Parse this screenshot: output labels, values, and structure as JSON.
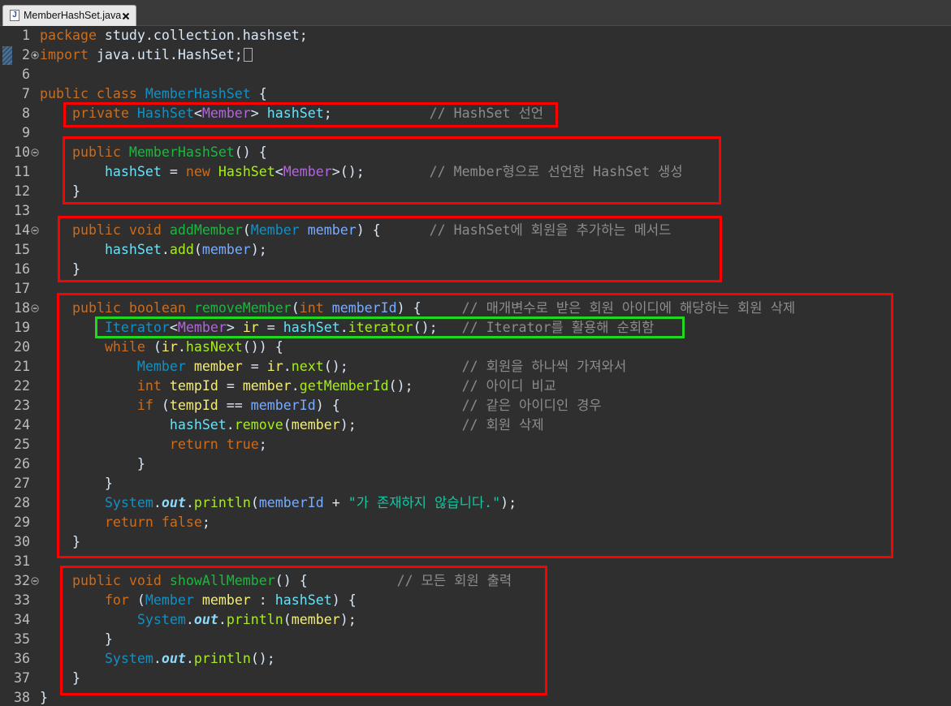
{
  "tab": {
    "icon": "java-file-icon",
    "icon_label": "J",
    "label": "MemberHashSet.java",
    "close_icon": "close-icon"
  },
  "syntax_colors": {
    "kw": "#CC6C1D",
    "pl": "#D9E8F7",
    "cls": "#1290C3",
    "ta": "#B166DA",
    "fld": "#66E1F8",
    "md": "#1EB540",
    "mc": "#A7EC21",
    "par": "#79ABFF",
    "loc": "#F3EC79",
    "sf": "#8DDAF8",
    "cm": "#8C8C8C",
    "str": "#17C6A3"
  },
  "highlight_colors": {
    "red": "#FF0000",
    "green": "#1FD81F"
  },
  "editor": {
    "lines": [
      {
        "number": "1",
        "tokens": [
          [
            "package",
            "kw"
          ],
          [
            " study.collection.hashset;",
            "pl"
          ]
        ]
      },
      {
        "number": "2",
        "fold": "fold-expand-icon",
        "gutter_marker": "quick-diff-marker-icon",
        "folded_marker": "folded-code-icon",
        "tokens": [
          [
            "import",
            "kw"
          ],
          [
            " java.util.HashSet;",
            "pl"
          ]
        ]
      },
      {
        "number": "6",
        "tokens": []
      },
      {
        "number": "7",
        "tokens": [
          [
            "public class",
            "kw"
          ],
          [
            " ",
            "pl"
          ],
          [
            "MemberHashSet",
            "cls"
          ],
          [
            " {",
            "pl"
          ]
        ]
      },
      {
        "number": "8",
        "tokens": [
          [
            "    ",
            "pl"
          ],
          [
            "private",
            "kw"
          ],
          [
            " ",
            "pl"
          ],
          [
            "HashSet",
            "cls"
          ],
          [
            "<",
            "pl"
          ],
          [
            "Member",
            "ta"
          ],
          [
            "> ",
            "pl"
          ],
          [
            "hashSet",
            "fld"
          ],
          [
            ";",
            "pl"
          ],
          [
            "            ",
            "pl"
          ],
          [
            "// HashSet 선언",
            "cm"
          ]
        ]
      },
      {
        "number": "9",
        "tokens": []
      },
      {
        "number": "10",
        "fold": "fold-collapse-icon",
        "tokens": [
          [
            "    ",
            "pl"
          ],
          [
            "public",
            "kw"
          ],
          [
            " ",
            "pl"
          ],
          [
            "MemberHashSet",
            "md"
          ],
          [
            "() {",
            "pl"
          ]
        ]
      },
      {
        "number": "11",
        "tokens": [
          [
            "        ",
            "pl"
          ],
          [
            "hashSet",
            "fld"
          ],
          [
            " = ",
            "pl"
          ],
          [
            "new",
            "kw"
          ],
          [
            " ",
            "pl"
          ],
          [
            "HashSet",
            "mc"
          ],
          [
            "<",
            "pl"
          ],
          [
            "Member",
            "ta"
          ],
          [
            ">();",
            "pl"
          ],
          [
            "        ",
            "pl"
          ],
          [
            "// Member형으로 선언한 HashSet 생성",
            "cm"
          ]
        ]
      },
      {
        "number": "12",
        "tokens": [
          [
            "    }",
            "pl"
          ]
        ]
      },
      {
        "number": "13",
        "tokens": []
      },
      {
        "number": "14",
        "fold": "fold-collapse-icon",
        "tokens": [
          [
            "    ",
            "pl"
          ],
          [
            "public void",
            "kw"
          ],
          [
            " ",
            "pl"
          ],
          [
            "addMember",
            "md"
          ],
          [
            "(",
            "pl"
          ],
          [
            "Member",
            "cls"
          ],
          [
            " ",
            "pl"
          ],
          [
            "member",
            "par"
          ],
          [
            ") {",
            "pl"
          ],
          [
            "      ",
            "pl"
          ],
          [
            "// HashSet에 회원을 추가하는 메서드",
            "cm"
          ]
        ]
      },
      {
        "number": "15",
        "tokens": [
          [
            "        ",
            "pl"
          ],
          [
            "hashSet",
            "fld"
          ],
          [
            ".",
            "pl"
          ],
          [
            "add",
            "mc"
          ],
          [
            "(",
            "pl"
          ],
          [
            "member",
            "par"
          ],
          [
            ");",
            "pl"
          ]
        ]
      },
      {
        "number": "16",
        "tokens": [
          [
            "    }",
            "pl"
          ]
        ]
      },
      {
        "number": "17",
        "tokens": []
      },
      {
        "number": "18",
        "fold": "fold-collapse-icon",
        "tokens": [
          [
            "    ",
            "pl"
          ],
          [
            "public boolean",
            "kw"
          ],
          [
            " ",
            "pl"
          ],
          [
            "removeMember",
            "md"
          ],
          [
            "(",
            "pl"
          ],
          [
            "int",
            "kw"
          ],
          [
            " ",
            "pl"
          ],
          [
            "memberId",
            "par"
          ],
          [
            ") {",
            "pl"
          ],
          [
            "     ",
            "pl"
          ],
          [
            "// 매개변수로 받은 회원 아이디에 해당하는 회원 삭제",
            "cm"
          ]
        ]
      },
      {
        "number": "19",
        "tokens": [
          [
            "        ",
            "pl"
          ],
          [
            "Iterator",
            "cls"
          ],
          [
            "<",
            "pl"
          ],
          [
            "Member",
            "ta"
          ],
          [
            "> ",
            "pl"
          ],
          [
            "ir",
            "loc"
          ],
          [
            " = ",
            "pl"
          ],
          [
            "hashSet",
            "fld"
          ],
          [
            ".",
            "pl"
          ],
          [
            "iterator",
            "mc"
          ],
          [
            "();",
            "pl"
          ],
          [
            "   ",
            "pl"
          ],
          [
            "// Iterator를 활용해 순회함",
            "cm"
          ]
        ]
      },
      {
        "number": "20",
        "tokens": [
          [
            "        ",
            "pl"
          ],
          [
            "while",
            "kw"
          ],
          [
            " (",
            "pl"
          ],
          [
            "ir",
            "loc"
          ],
          [
            ".",
            "pl"
          ],
          [
            "hasNext",
            "mc"
          ],
          [
            "()) {",
            "pl"
          ]
        ]
      },
      {
        "number": "21",
        "tokens": [
          [
            "            ",
            "pl"
          ],
          [
            "Member",
            "cls"
          ],
          [
            " ",
            "pl"
          ],
          [
            "member",
            "loc"
          ],
          [
            " = ",
            "pl"
          ],
          [
            "ir",
            "loc"
          ],
          [
            ".",
            "pl"
          ],
          [
            "next",
            "mc"
          ],
          [
            "();",
            "pl"
          ],
          [
            "              ",
            "pl"
          ],
          [
            "// 회원을 하나씩 가져와서",
            "cm"
          ]
        ]
      },
      {
        "number": "22",
        "tokens": [
          [
            "            ",
            "pl"
          ],
          [
            "int",
            "kw"
          ],
          [
            " ",
            "pl"
          ],
          [
            "tempId",
            "loc"
          ],
          [
            " = ",
            "pl"
          ],
          [
            "member",
            "loc"
          ],
          [
            ".",
            "pl"
          ],
          [
            "getMemberId",
            "mc"
          ],
          [
            "();",
            "pl"
          ],
          [
            "      ",
            "pl"
          ],
          [
            "// 아이디 비교",
            "cm"
          ]
        ]
      },
      {
        "number": "23",
        "tokens": [
          [
            "            ",
            "pl"
          ],
          [
            "if",
            "kw"
          ],
          [
            " (",
            "pl"
          ],
          [
            "tempId",
            "loc"
          ],
          [
            " == ",
            "pl"
          ],
          [
            "memberId",
            "par"
          ],
          [
            ") {",
            "pl"
          ],
          [
            "               ",
            "pl"
          ],
          [
            "// 같은 아이디인 경우",
            "cm"
          ]
        ]
      },
      {
        "number": "24",
        "tokens": [
          [
            "                ",
            "pl"
          ],
          [
            "hashSet",
            "fld"
          ],
          [
            ".",
            "pl"
          ],
          [
            "remove",
            "mc"
          ],
          [
            "(",
            "pl"
          ],
          [
            "member",
            "loc"
          ],
          [
            ");",
            "pl"
          ],
          [
            "             ",
            "pl"
          ],
          [
            "// 회원 삭제",
            "cm"
          ]
        ]
      },
      {
        "number": "25",
        "tokens": [
          [
            "                ",
            "pl"
          ],
          [
            "return true",
            "kw"
          ],
          [
            ";",
            "pl"
          ]
        ]
      },
      {
        "number": "26",
        "tokens": [
          [
            "            }",
            "pl"
          ]
        ]
      },
      {
        "number": "27",
        "tokens": [
          [
            "        }",
            "pl"
          ]
        ]
      },
      {
        "number": "28",
        "tokens": [
          [
            "        ",
            "pl"
          ],
          [
            "System",
            "cls"
          ],
          [
            ".",
            "pl"
          ],
          [
            "out",
            "sf"
          ],
          [
            ".",
            "pl"
          ],
          [
            "println",
            "mc"
          ],
          [
            "(",
            "pl"
          ],
          [
            "memberId",
            "par"
          ],
          [
            " + ",
            "pl"
          ],
          [
            "\"가 존재하지 않습니다.\"",
            "str"
          ],
          [
            ");",
            "pl"
          ]
        ]
      },
      {
        "number": "29",
        "tokens": [
          [
            "        ",
            "pl"
          ],
          [
            "return false",
            "kw"
          ],
          [
            ";",
            "pl"
          ]
        ]
      },
      {
        "number": "30",
        "tokens": [
          [
            "    }",
            "pl"
          ]
        ]
      },
      {
        "number": "31",
        "tokens": []
      },
      {
        "number": "32",
        "fold": "fold-collapse-icon",
        "tokens": [
          [
            "    ",
            "pl"
          ],
          [
            "public void",
            "kw"
          ],
          [
            " ",
            "pl"
          ],
          [
            "showAllMember",
            "md"
          ],
          [
            "() {",
            "pl"
          ],
          [
            "           ",
            "pl"
          ],
          [
            "// 모든 회원 출력",
            "cm"
          ]
        ]
      },
      {
        "number": "33",
        "tokens": [
          [
            "        ",
            "pl"
          ],
          [
            "for",
            "kw"
          ],
          [
            " (",
            "pl"
          ],
          [
            "Member",
            "cls"
          ],
          [
            " ",
            "pl"
          ],
          [
            "member",
            "loc"
          ],
          [
            " : ",
            "pl"
          ],
          [
            "hashSet",
            "fld"
          ],
          [
            ") {",
            "pl"
          ]
        ]
      },
      {
        "number": "34",
        "tokens": [
          [
            "            ",
            "pl"
          ],
          [
            "System",
            "cls"
          ],
          [
            ".",
            "pl"
          ],
          [
            "out",
            "sf"
          ],
          [
            ".",
            "pl"
          ],
          [
            "println",
            "mc"
          ],
          [
            "(",
            "pl"
          ],
          [
            "member",
            "loc"
          ],
          [
            ");",
            "pl"
          ]
        ]
      },
      {
        "number": "35",
        "tokens": [
          [
            "        }",
            "pl"
          ]
        ]
      },
      {
        "number": "36",
        "tokens": [
          [
            "        ",
            "pl"
          ],
          [
            "System",
            "cls"
          ],
          [
            ".",
            "pl"
          ],
          [
            "out",
            "sf"
          ],
          [
            ".",
            "pl"
          ],
          [
            "println",
            "mc"
          ],
          [
            "();",
            "pl"
          ]
        ]
      },
      {
        "number": "37",
        "tokens": [
          [
            "    }",
            "pl"
          ]
        ]
      },
      {
        "number": "38",
        "tokens": [
          [
            "}",
            "pl"
          ]
        ]
      }
    ]
  }
}
